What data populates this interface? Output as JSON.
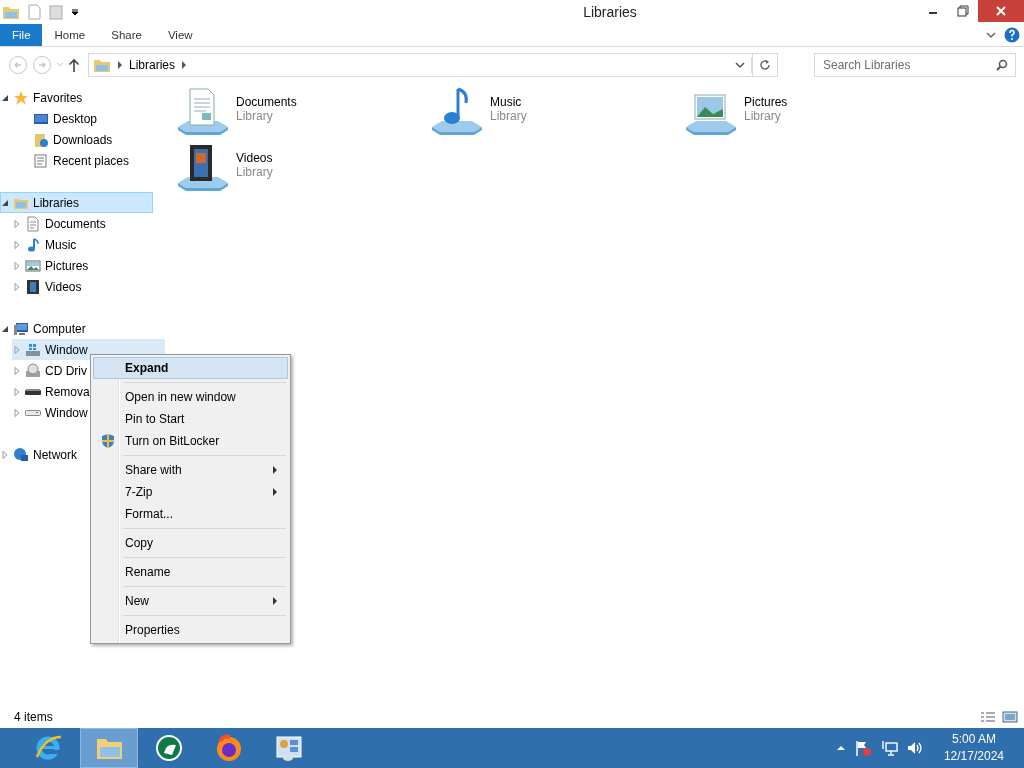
{
  "window": {
    "title": "Libraries"
  },
  "ribbon": {
    "tabs": [
      {
        "label": "File",
        "kind": "file",
        "selected": false
      },
      {
        "label": "Home",
        "kind": "tab",
        "selected": false
      },
      {
        "label": "Share",
        "kind": "tab",
        "selected": false
      },
      {
        "label": "View",
        "kind": "tab",
        "selected": false
      }
    ]
  },
  "address_bar": {
    "path": [
      "Libraries"
    ]
  },
  "search": {
    "placeholder": "Search Libraries"
  },
  "navigation": {
    "items": [
      {
        "label": "Favorites",
        "kind": "star",
        "expanded": true,
        "selected": false,
        "children": [
          {
            "label": "Desktop",
            "kind": "desktop",
            "selected": false
          },
          {
            "label": "Downloads",
            "kind": "downloads",
            "selected": false
          },
          {
            "label": "Recent places",
            "kind": "recent",
            "selected": false
          }
        ]
      },
      {
        "label": "Libraries",
        "kind": "libraries",
        "expanded": true,
        "selected": true,
        "children": [
          {
            "label": "Documents",
            "kind": "documents",
            "expanded": false,
            "selected": false
          },
          {
            "label": "Music",
            "kind": "music",
            "expanded": false,
            "selected": false
          },
          {
            "label": "Pictures",
            "kind": "pictures",
            "expanded": false,
            "selected": false
          },
          {
            "label": "Videos",
            "kind": "videos",
            "expanded": false,
            "selected": false
          }
        ]
      },
      {
        "label": "Computer",
        "kind": "computer",
        "expanded": true,
        "selected": false,
        "children": [
          {
            "label": "Window",
            "kind": "windrive",
            "expanded": false,
            "selected": false,
            "hot": true
          },
          {
            "label": "CD Driv",
            "kind": "cd",
            "expanded": false,
            "selected": false
          },
          {
            "label": "Remova",
            "kind": "removable",
            "expanded": false,
            "selected": false
          },
          {
            "label": "Window",
            "kind": "drive",
            "expanded": false,
            "selected": false
          }
        ]
      },
      {
        "label": "Network",
        "kind": "network",
        "expanded": false,
        "selected": false
      }
    ]
  },
  "content": {
    "items": [
      {
        "name": "Documents",
        "subtitle": "Library",
        "kind": "documents"
      },
      {
        "name": "Music",
        "subtitle": "Library",
        "kind": "music"
      },
      {
        "name": "Pictures",
        "subtitle": "Library",
        "kind": "pictures"
      },
      {
        "name": "Videos",
        "subtitle": "Library",
        "kind": "videos"
      }
    ]
  },
  "context_menu": {
    "groups": [
      [
        {
          "label": "Expand",
          "default": true,
          "selected": true,
          "submenu": false
        }
      ],
      [
        {
          "label": "Open in new window",
          "default": false,
          "selected": false,
          "submenu": false
        },
        {
          "label": "Pin to Start",
          "default": false,
          "selected": false,
          "submenu": false
        },
        {
          "label": "Turn on BitLocker",
          "default": false,
          "selected": false,
          "submenu": false,
          "kind": "shield"
        }
      ],
      [
        {
          "label": "Share with",
          "default": false,
          "selected": false,
          "submenu": true
        },
        {
          "label": "7-Zip",
          "default": false,
          "selected": false,
          "submenu": true
        },
        {
          "label": "Format...",
          "default": false,
          "selected": false,
          "submenu": false
        }
      ],
      [
        {
          "label": "Copy",
          "default": false,
          "selected": false,
          "submenu": false
        }
      ],
      [
        {
          "label": "Rename",
          "default": false,
          "selected": false,
          "submenu": false
        }
      ],
      [
        {
          "label": "New",
          "default": false,
          "selected": false,
          "submenu": true
        }
      ],
      [
        {
          "label": "Properties",
          "default": false,
          "selected": false,
          "submenu": false
        }
      ]
    ]
  },
  "status_bar": {
    "text": "4 items"
  },
  "taskbar": {
    "apps": [
      {
        "kind": "ie",
        "selected": false
      },
      {
        "kind": "explorer",
        "selected": true
      },
      {
        "kind": "green",
        "selected": false
      },
      {
        "kind": "firefox",
        "selected": false
      },
      {
        "kind": "control",
        "selected": false
      }
    ],
    "clock": {
      "time": "5:00 AM",
      "date": "12/17/2024"
    }
  }
}
